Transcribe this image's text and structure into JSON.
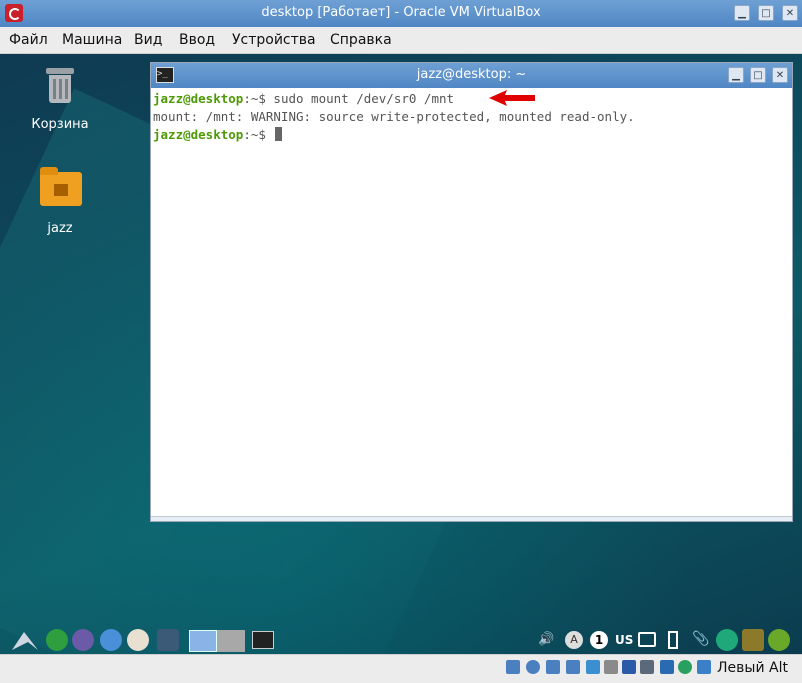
{
  "window": {
    "title": "desktop [Работает] - Oracle VM VirtualBox"
  },
  "menu": [
    "Файл",
    "Машина",
    "Вид",
    "Ввод",
    "Устройства",
    "Справка"
  ],
  "desktop_icons": [
    {
      "label": "Корзина",
      "icon": "trash-icon"
    },
    {
      "label": "jazz",
      "icon": "home-folder-icon"
    }
  ],
  "terminal": {
    "title": "jazz@desktop: ~",
    "lines": [
      {
        "prompt": "jazz@desktop",
        "path": ":~$",
        "cmd": " sudo mount /dev/sr0 /mnt"
      },
      {
        "output": "mount: /mnt: WARNING: source write-protected, mounted read-only."
      },
      {
        "prompt": "jazz@desktop",
        "path": ":~$",
        "cmd": " "
      }
    ]
  },
  "panel": {
    "keyboard_layout": "US",
    "workspace_number": "1",
    "accessibility_letter": "A"
  },
  "statusbar": {
    "host_key": "Левый Alt"
  },
  "colors": {
    "title_bar": "#4f86c4",
    "prompt": "#4e9a06",
    "arrow": "#e00000"
  }
}
